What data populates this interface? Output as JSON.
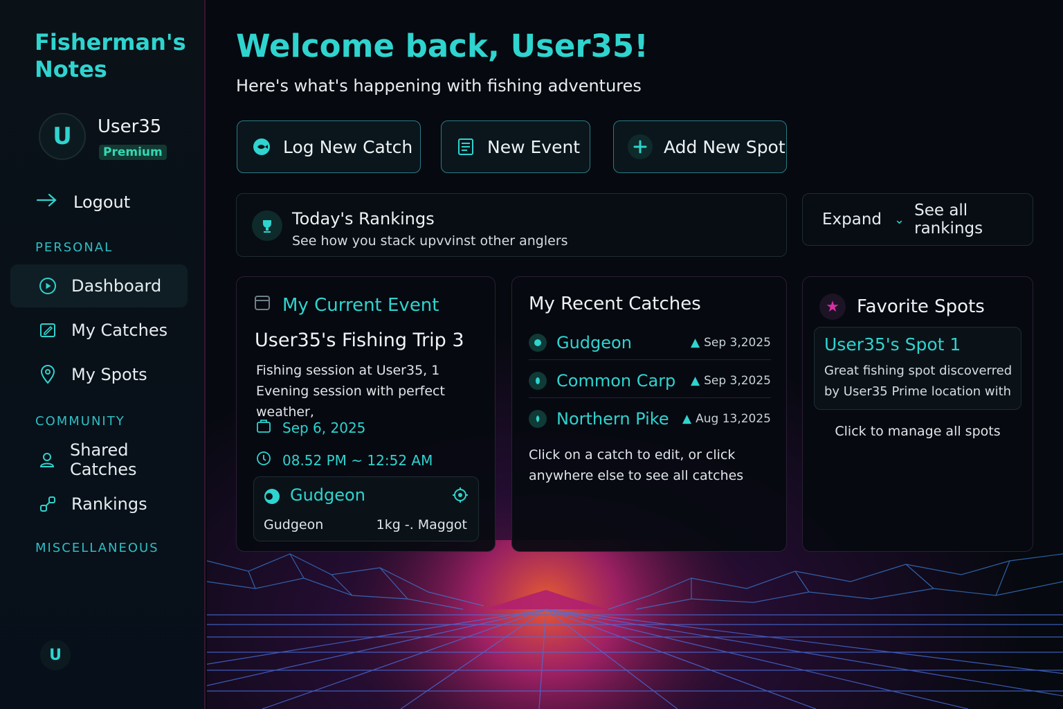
{
  "sidebar": {
    "brand": "Fisherman's Notes",
    "user": {
      "initial": "U",
      "name": "User35",
      "tier": "Premium"
    },
    "logout_label": "Logout",
    "sections": {
      "personal": "PERSONAL",
      "community": "COMMUNITY",
      "misc": "MISCELLANEOUS"
    },
    "items": [
      {
        "label": "Dashboard",
        "icon": "play-circle-icon"
      },
      {
        "label": "My Catches",
        "icon": "edit-note-icon"
      },
      {
        "label": "My Spots",
        "icon": "map-pin-icon"
      },
      {
        "label": "Shared Catches",
        "icon": "user-icon"
      },
      {
        "label": "Rankings",
        "icon": "link-icon"
      }
    ],
    "bottom_initial": "U"
  },
  "header": {
    "welcome": "Welcome back, User35!",
    "subtitle": "Here's what's happening with fishing adventures"
  },
  "actions": {
    "log_catch": "Log New Catch",
    "new_event": "New Event",
    "add_spot": "Add New Spot"
  },
  "rankings": {
    "title": "Today's Rankings",
    "subtitle": "See how you stack upvvinst other anglers",
    "expand": "Expand",
    "see_all": "See all rankings"
  },
  "current_event": {
    "title": "My Current Event",
    "name": "User35's Fishing Trip 3",
    "description": "Fishing session at User35, 1 Evening session with perfect weather,",
    "date": "Sep 6, 2025",
    "time": "08.52 PM ~ 12:52 AM",
    "catch": {
      "name": "Gudgeon",
      "species": "Gudgeon",
      "detail": "1kg -. Maggot"
    }
  },
  "recent_catches": {
    "title": "My Recent Catches",
    "items": [
      {
        "name": "Gudgeon",
        "date": "Sep 3,2025"
      },
      {
        "name": "Common Carp",
        "date": "Sep 3,2025"
      },
      {
        "name": "Northern Pike",
        "date": "Aug 13,2025"
      }
    ],
    "note": "Click on a catch to edit, or click anywhere else to see all catches"
  },
  "favorite_spots": {
    "title": "Favorite Spots",
    "spot": {
      "name": "User35's Spot 1",
      "description": "Great fishing spot discoverred by User35 Prime location with"
    },
    "manage": "Click to manage all spots"
  },
  "colors": {
    "accent": "#2fd4cf",
    "magenta": "#d62fa6",
    "background": "#06090f"
  }
}
